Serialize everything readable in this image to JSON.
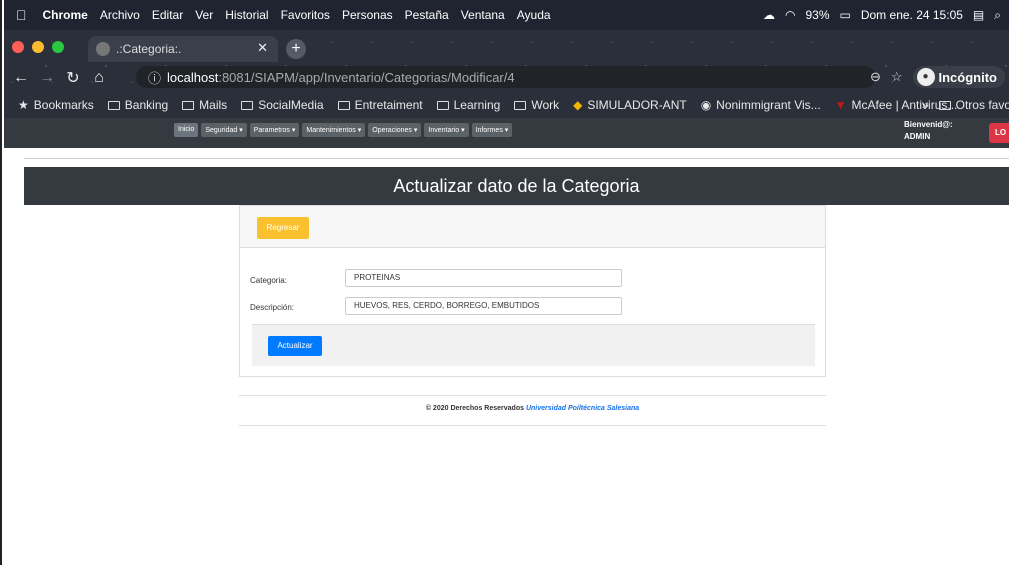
{
  "menubar": {
    "apple": "",
    "items": [
      "Chrome",
      "Archivo",
      "Editar",
      "Ver",
      "Historial",
      "Favoritos",
      "Personas",
      "Pestaña",
      "Ventana",
      "Ayuda"
    ],
    "battery": "93%",
    "datetime": "Dom ene. 24  15:05"
  },
  "browser": {
    "tab_title": ".:Categoria:.",
    "url_host": "localhost",
    "url_path": ":8081/SIAPM/app/Inventario/Categorias/Modificar/4",
    "incognito_label": "Incógnito",
    "bookmarks": [
      "Bookmarks",
      "Banking",
      "Mails",
      "SocialMedia",
      "Entretaiment",
      "Learning",
      "Work",
      "SIMULADOR-ANT",
      "Nonimmigrant Vis...",
      "McAfee | Antivirus..."
    ],
    "bookmarks_more": "»",
    "bookmarks_other": "Otros favo"
  },
  "site_nav": {
    "items": [
      "Inicio",
      "Seguridad ▾",
      "Parametros ▾",
      "Mantenimientos ▾",
      "Operaciones ▾",
      "Inventario ▾",
      "Informes ▾"
    ],
    "welcome_line1": "Bienvenid@:",
    "welcome_line2": "ADMIN",
    "logout_label": "LO"
  },
  "page": {
    "title": "Actualizar dato de la Categoria",
    "back_label": "Regresar",
    "categoria_label": "Categoria:",
    "categoria_value": "PROTEINAS",
    "descripcion_label": "Descripción:",
    "descripcion_value": "HUEVOS, RES, CERDO, BORREGO, EMBUTIDOS",
    "update_label": "Actualizar"
  },
  "footer": {
    "text": "© 2020 Derechos Reservados",
    "link": "Universidad Poiltécnica Salesiana"
  },
  "colors": {
    "navbar": "#343a40",
    "warning": "#fbc02d",
    "primary": "#007bff",
    "danger": "#dc3545"
  }
}
